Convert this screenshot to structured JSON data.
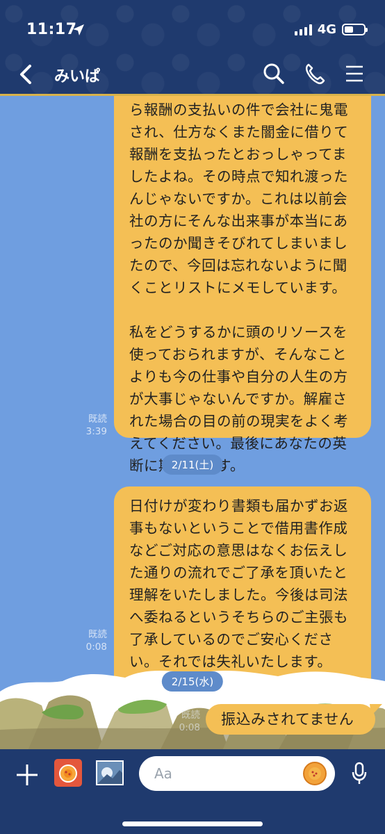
{
  "status": {
    "time": "11:17",
    "network": "4G"
  },
  "header": {
    "title": "みいぱ"
  },
  "messages": [
    {
      "text": "ら報酬の支払いの件で会社に鬼電\nされ、仕方なくまた闇金に借りて\n報酬を支払ったとおっしゃってま\nしたよね。その時点で知れ渡った\nんじゃないですか。これは以前会\n社の方にそんな出来事が本当にあ\nったのか聞きそびれてしまいまし\nたので、今回は忘れないように聞\nくことリストにメモしています。\n\n私をどうするかに頭のリソースを\n使っておられますが、そんなこと\nよりも今の仕事や自分の人生の方\nが大事じゃないんですか。解雇さ\nれた場合の目の前の現実をよく考\nえてください。最後にあなたの英\n断に期待します。",
      "read": "既読",
      "time": "3:39"
    },
    {
      "text": "日付けが変わり書類も届かずお返\n事もないということで借用書作成\nなどご対応の意思はなくお伝えし\nた通りの流れでご了承を頂いたと\n理解をいたしました。今後は司法\nへ委ねるというそちらのご主張も\n了承しているのでご安心くださ\nい。それでは失礼いたします。",
      "read": "既読",
      "time": "0:08"
    },
    {
      "text": "振込みされてません",
      "read": "既読",
      "time": "0:08"
    }
  ],
  "dates": {
    "d1": "2/11(土)",
    "d2": "2/15(水)"
  },
  "input": {
    "placeholder": "Aa"
  },
  "colors": {
    "navy": "#1f3a6e",
    "bubble": "#f4bf55",
    "background": "#6f9ee0"
  }
}
